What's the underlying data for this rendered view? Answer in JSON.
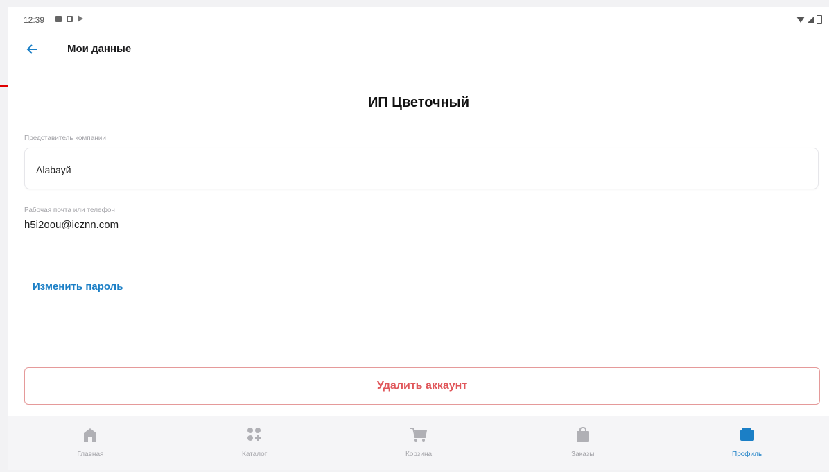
{
  "status_bar": {
    "time": "12:39"
  },
  "header": {
    "title": "Мои данные",
    "back_icon": "arrow-left-icon"
  },
  "company": {
    "name": "ИП Цветочный"
  },
  "representative": {
    "label": "Представитель компании",
    "value": "Alabayй"
  },
  "contact": {
    "label": "Рабочая почта или телефон",
    "value": "h5i2oou@icznn.com"
  },
  "change_password": {
    "label": "Изменить пароль"
  },
  "delete_account": {
    "label": "Удалить аккаунт"
  },
  "bottom_nav": {
    "items": [
      {
        "label": "Главная",
        "icon": "home-icon"
      },
      {
        "label": "Каталог",
        "icon": "catalog-icon"
      },
      {
        "label": "Корзина",
        "icon": "cart-icon"
      },
      {
        "label": "Заказы",
        "icon": "orders-bag-icon"
      },
      {
        "label": "Профиль",
        "icon": "profile-wallet-icon"
      }
    ],
    "active": "Профиль"
  },
  "colors": {
    "accent": "#1b7fc6",
    "danger": "#e0575b",
    "danger_border": "#e59a9a",
    "annotation": "#e00000"
  }
}
